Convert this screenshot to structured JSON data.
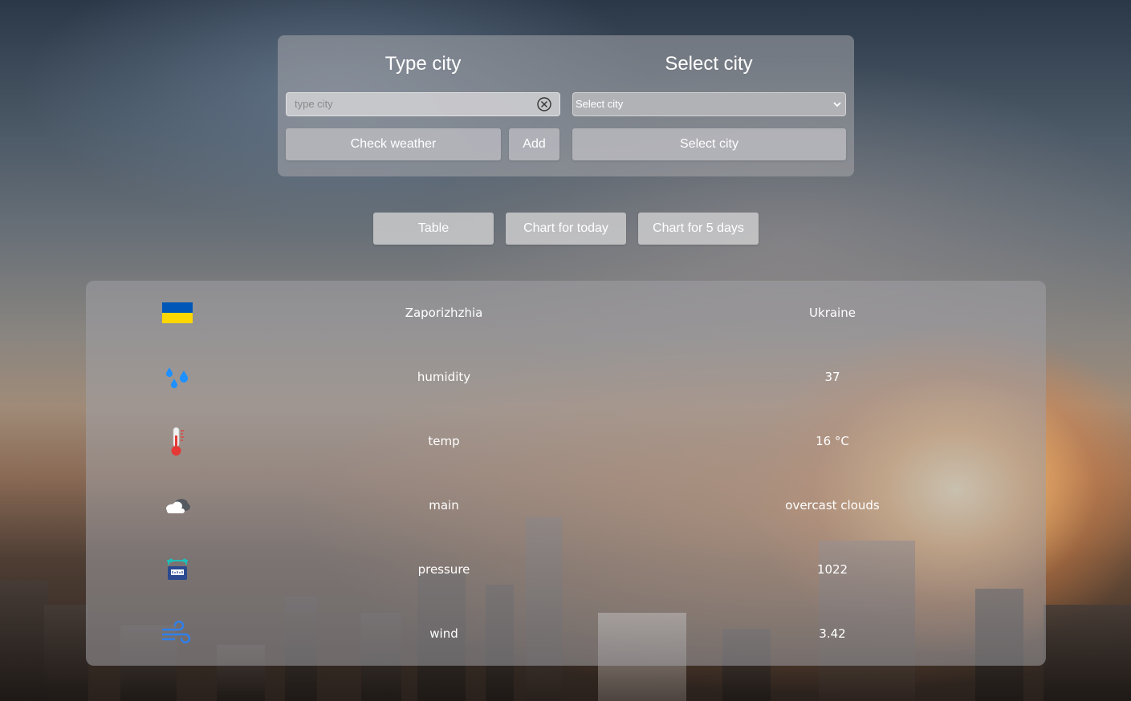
{
  "search": {
    "type_title": "Type city",
    "select_title": "Select city",
    "input_placeholder": "type city",
    "select_value": "Select city",
    "check_weather_label": "Check weather",
    "add_label": "Add",
    "select_city_button_label": "Select city"
  },
  "tabs": {
    "table": "Table",
    "chart_today": "Chart for today",
    "chart_5_days": "Chart for 5 days"
  },
  "weather": {
    "city": "Zaporizhzhia",
    "country": "Ukraine",
    "rows": [
      {
        "label": "humidity",
        "value": "37",
        "icon": "humidity-icon"
      },
      {
        "label": "temp",
        "value": "16 °C",
        "icon": "thermometer-icon"
      },
      {
        "label": "main",
        "value": "overcast clouds",
        "icon": "cloud-icon"
      },
      {
        "label": "pressure",
        "value": "1022",
        "icon": "pressure-gauge-icon"
      },
      {
        "label": "wind",
        "value": "3.42",
        "icon": "wind-icon"
      }
    ]
  },
  "colors": {
    "flag_blue": "#0057B7",
    "flag_yellow": "#FFD700",
    "humidity_blue": "#1e90ff",
    "thermo_red": "#e53935",
    "wind_blue": "#2f80ed"
  }
}
